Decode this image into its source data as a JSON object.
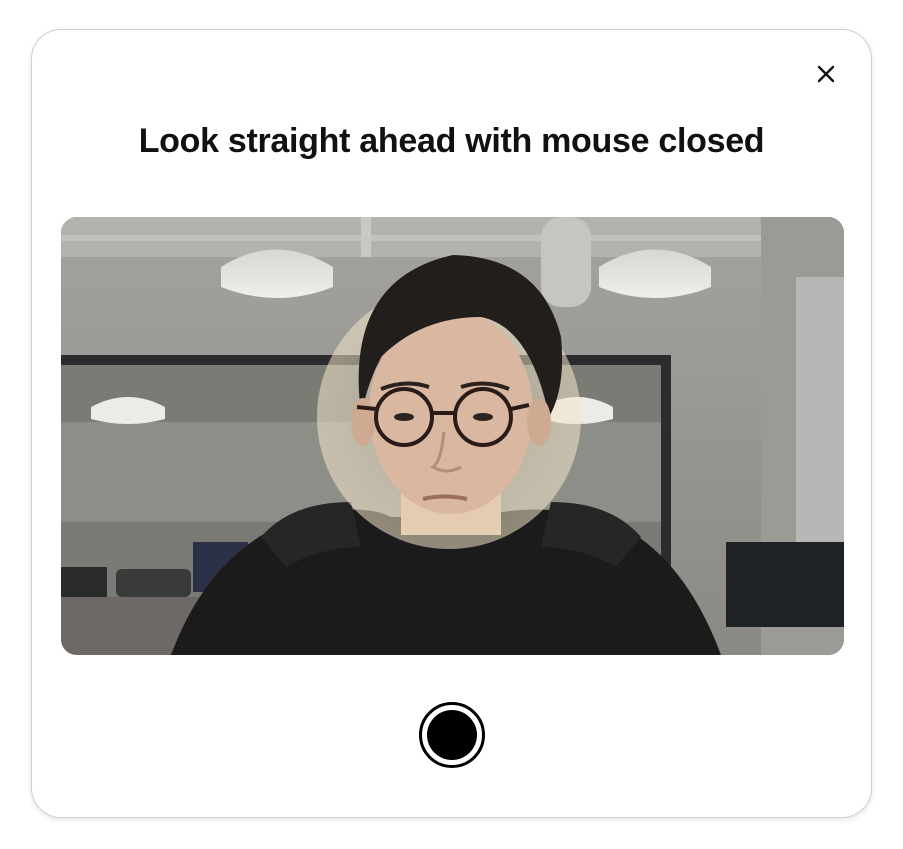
{
  "dialog": {
    "title": "Look straight ahead with mouse closed",
    "close_icon": "close-icon",
    "shutter_icon": "record-circle-icon"
  },
  "camera_preview": {
    "description_icon": "camera-feed",
    "overlay": "face-guide-circle"
  },
  "colors": {
    "title_text": "#111111",
    "modal_border": "#cfcfcf",
    "shutter": "#000000"
  }
}
